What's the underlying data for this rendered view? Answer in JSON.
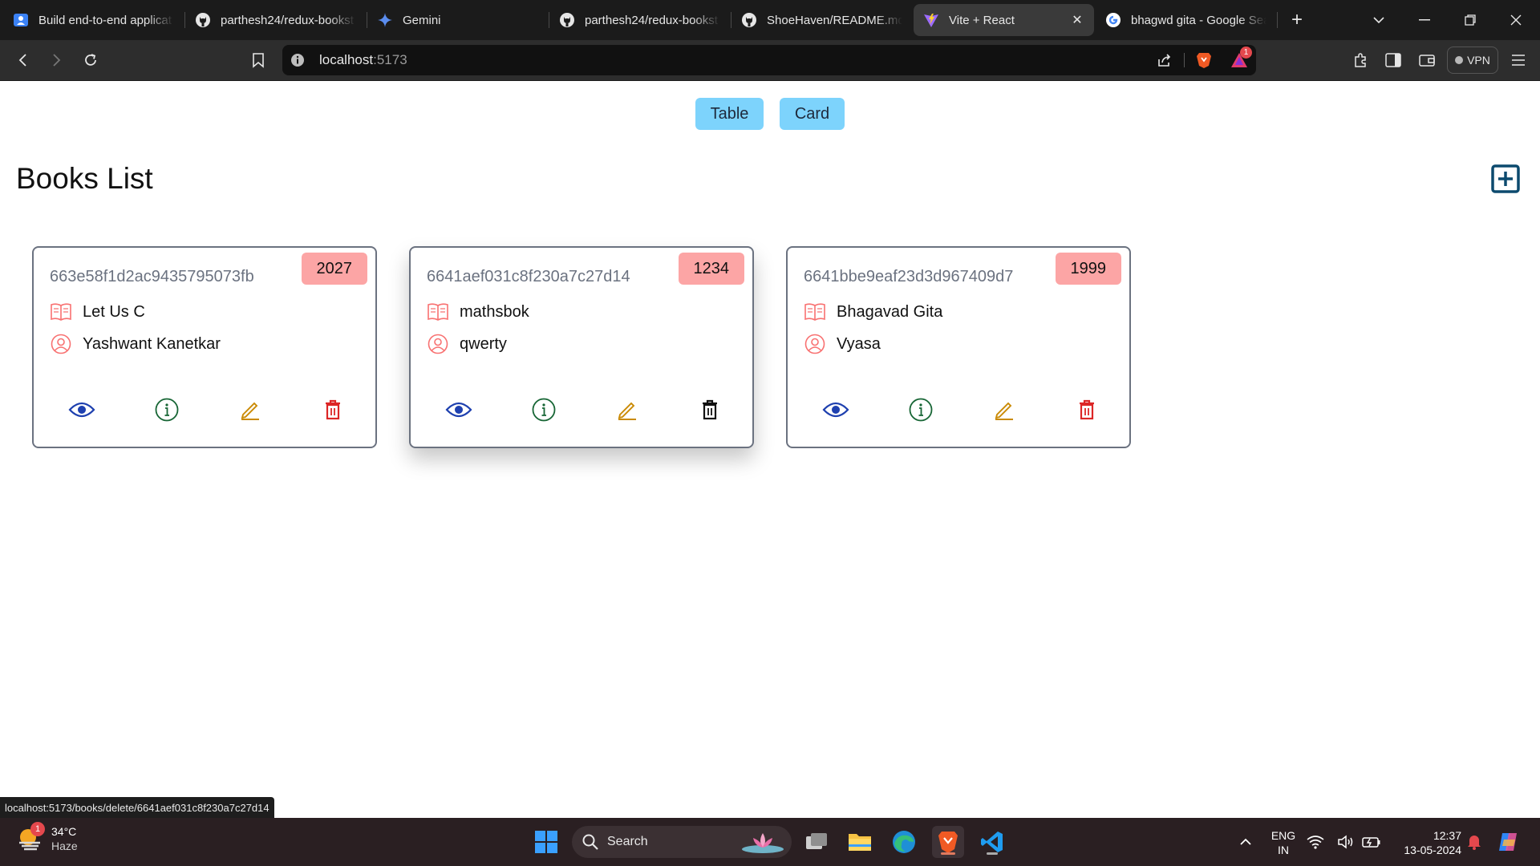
{
  "browser": {
    "tabs": [
      {
        "title": "Build end-to-end applicat",
        "icon": "app-icon",
        "active": false
      },
      {
        "title": "parthesh24/redux-bookst",
        "icon": "github-icon",
        "active": false
      },
      {
        "title": "Gemini",
        "icon": "gemini-icon",
        "active": false
      },
      {
        "title": "parthesh24/redux-bookst",
        "icon": "github-icon",
        "active": false
      },
      {
        "title": "ShoeHaven/README.md",
        "icon": "github-icon",
        "active": false
      },
      {
        "title": "Vite + React",
        "icon": "vite-icon",
        "active": true
      },
      {
        "title": "bhagwd gita - Google Sea",
        "icon": "google-icon",
        "active": false
      }
    ],
    "url_host": "localhost",
    "url_port": ":5173",
    "vpn_label": "VPN",
    "alert_count": "1",
    "status_bar_url": "localhost:5173/books/delete/6641aef031c8f230a7c27d14"
  },
  "page": {
    "view_toggle": {
      "table_label": "Table",
      "card_label": "Card"
    },
    "title": "Books List",
    "books": [
      {
        "id": "663e58f1d2ac9435795073fb",
        "title": "Let Us C",
        "author": "Yashwant Kanetkar",
        "year": "2027",
        "hovered": false
      },
      {
        "id": "6641aef031c8f230a7c27d14",
        "title": "mathsbok",
        "author": "qwerty",
        "year": "1234",
        "hovered": true
      },
      {
        "id": "6641bbe9eaf23d3d967409d7",
        "title": "Bhagavad Gita",
        "author": "Vyasa",
        "year": "1999",
        "hovered": false
      }
    ],
    "colors": {
      "toggle_bg": "#7dd3fc",
      "year_badge": "#fca5a5",
      "show_icon": "#1e40af",
      "info_icon": "#166534",
      "edit_icon": "#ca8a04",
      "delete_icon": "#dc2626",
      "row_icon": "#f87171",
      "add_icon": "#0c4a6e"
    }
  },
  "taskbar": {
    "weather_temp": "34°C",
    "weather_desc": "Haze",
    "weather_badge": "1",
    "search_label": "Search",
    "lang_line1": "ENG",
    "lang_line2": "IN",
    "time": "12:37",
    "date": "13-05-2024"
  }
}
